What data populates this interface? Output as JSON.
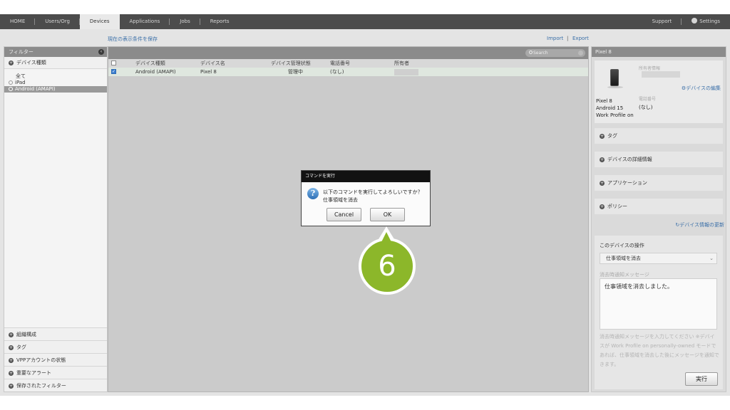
{
  "nav": {
    "items": [
      "HOME",
      "Users/Org",
      "Devices",
      "Applications",
      "Jobs",
      "Reports"
    ],
    "active": "Devices",
    "support": "Support",
    "settings": "Settings"
  },
  "toolbar": {
    "save_view": "現在の表示条件を保存",
    "import": "Import",
    "divider": "|",
    "export": "Export"
  },
  "filter": {
    "title": "フィルター",
    "device_type_section": "デバイス種類",
    "options": [
      "全て",
      "iPad",
      "Android (AMAPI)"
    ],
    "selected": "Android (AMAPI)",
    "bottom_sections": [
      "組織構成",
      "タグ",
      "VPPアカウントの状態",
      "重要なアラート",
      "保存されたフィルター"
    ]
  },
  "list": {
    "search_placeholder": "Search",
    "columns": [
      "デバイス種類",
      "デバイス名",
      "デバイス管理状態",
      "電話番号",
      "所有者"
    ],
    "rows": [
      {
        "type": "Android (AMAPI)",
        "name": "Pixel 8",
        "status": "管理中",
        "phone": "(なし)",
        "checked": true
      }
    ]
  },
  "dialog": {
    "title": "コマンドを実行",
    "line1": "以下のコマンドを実行してよろしいですか？",
    "line2": "仕事領域を消去",
    "cancel": "Cancel",
    "ok": "OK"
  },
  "callout": {
    "step": "6",
    "color": "#8cb72a"
  },
  "detail": {
    "header": "Pixel 8",
    "owner_label": "所有者情報",
    "edit_link": "デバイスの編集",
    "phone_label": "電話番号",
    "phone_value": "(なし)",
    "model": "Pixel 8",
    "os": "Android 15",
    "profile": "Work Profile on",
    "sections": [
      "タグ",
      "デバイスの詳細情報",
      "アプリケーション",
      "ポリシー"
    ],
    "refresh_link": "デバイス情報の更新",
    "operation": {
      "title": "このデバイスの操作",
      "selected": "仕事領域を消去",
      "msg_label": "消去時通知メッセージ",
      "msg_value": "仕事領域を消去しました。",
      "hint": "消去時通知メッセージを入力してください ※デバイスが Work Profile on personally-owned モードであれば、仕事領域を消去した後にメッセージを通知できます。",
      "run": "実行"
    }
  }
}
